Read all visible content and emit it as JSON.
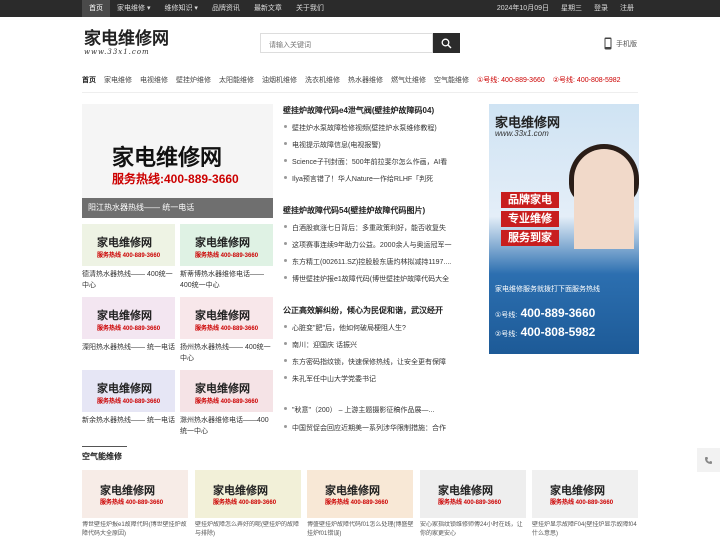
{
  "topbar": {
    "nav": [
      "首页",
      "家电维修",
      "维修知识",
      "品牌资讯",
      "最新文章",
      "关于我们"
    ],
    "date": "2024年10月09日",
    "weekday": "星期三",
    "login": "登录",
    "register": "注册"
  },
  "logo": {
    "title": "家电维修网",
    "url": "www.33x1.com"
  },
  "search": {
    "placeholder": "请输入关键词"
  },
  "mobile": {
    "label": "手机版"
  },
  "catnav": {
    "items": [
      "首页",
      "家电维修",
      "电视维修",
      "壁挂炉维修",
      "太阳能维修",
      "油烟机维修",
      "洗衣机维修",
      "热水器维修",
      "燃气灶维修",
      "空气能维修"
    ],
    "hot1": "①号线: 400-889-3660",
    "hot2": "②号线: 400-808-5982"
  },
  "banner": {
    "t1": "家电维修网",
    "t2": "服务热线:400-889-3660",
    "caption": "阳江热水器热线—— 统一电话"
  },
  "thumbs": [
    {
      "a": "家电维修网",
      "b": "服务热线 400-889-3660",
      "caption": "德清热水器热线—— 400统一中心"
    },
    {
      "a": "家电维修网",
      "b": "服务热线 400-889-3660",
      "caption": "斯蒂博热水器维修电话——400统一中心"
    },
    {
      "a": "家电维修网",
      "b": "服务热线 400-889-3660",
      "caption": "溧阳热水器热线—— 统一电话"
    },
    {
      "a": "家电维修网",
      "b": "服务热线 400-889-3660",
      "caption": "扬州热水器热线—— 400统一中心"
    },
    {
      "a": "家电维修网",
      "b": "服务热线 400-889-3660",
      "caption": "新余热水器热线—— 统一电话"
    },
    {
      "a": "家电维修网",
      "b": "服务热线 400-889-3660",
      "caption": "滁州热水器维修电话——400统一中心"
    }
  ],
  "mid": {
    "g1": {
      "h": "壁挂炉故障代码e4泄气阀(壁挂炉故障码04)",
      "items": [
        "壁挂炉水泵故障检修视频(壁挂炉水泵维修教程)",
        "电视提示故障信息(电视报警)",
        "Science子刊封面：500年前拉斐尔怎么作画，AI看",
        "Ilya预言错了！华人Nature一作给RLHF「判死"
      ]
    },
    "g2": {
      "h": "壁挂炉故障代码54(壁挂炉故障代码图片)",
      "items": [
        "白酒股疯涨七日背后：多重政策利好，能否收复失",
        "这项赛事连续9年助力公益。2000余人与奥运冠军一",
        "东方精工(002611.SZ)控股股东唐灼林拟减持1197....",
        "博世壁挂炉报e1故障代码(博世壁挂炉故障代码大全"
      ]
    },
    "g3": {
      "h": "公正高效解纠纷，倾心为民促和谐，武汉经开",
      "items": [
        "心脏变\"肥\"后，他如何破局梗阻人生?",
        "南川：迎国庆 话振兴",
        "东方密码指纹锁，快速保修热线，让安全更有保障",
        "朱孔军任中山大学党委书记"
      ]
    },
    "g4": {
      "items": [
        "\"秋意\"（200） – 上游主题摄影征稿作品展—...",
        "中国贸促会回应近期美一系列涉华限制措施：合作"
      ]
    }
  },
  "ad": {
    "l1": "家电维修网",
    "l2": "www.33x1.com",
    "s1": "品牌家电",
    "s2": "专业维修",
    "s3": "服务到家",
    "line": "家电维修服务就拨打下面服务热线",
    "p1n": "①号线:",
    "p1": "400-889-3660",
    "p2n": "②号线:",
    "p2": "400-808-5982"
  },
  "section": {
    "title": "空气能维修"
  },
  "cards": [
    {
      "a": "家电维修网",
      "b": "服务热线 400-889-3660",
      "caption": "博世壁挂炉报e1故障代码(博世壁挂炉故障代码大全原因)"
    },
    {
      "a": "家电维修网",
      "b": "服务热线 400-889-3660",
      "caption": "壁挂炉故障怎么弄好的呢(壁挂炉的故障与排除)"
    },
    {
      "a": "家电维修网",
      "b": "服务热线 400-889-3660",
      "caption": "博盛壁挂炉故障代码f01怎么处理(博盛壁挂炉f01错误)"
    },
    {
      "a": "家电维修网",
      "b": "服务热线 400-889-3660",
      "caption": "安心家指纹锁维修师傅24小时在线，让你的家更安心"
    },
    {
      "a": "家电维修网",
      "b": "服务热线 400-889-3660",
      "caption": "壁挂炉显示故障F04(壁挂炉显示故障f04什么意思)"
    }
  ],
  "colors": {
    "topbar": "#2b2b2b",
    "accent_red": "#cc0000",
    "ad_blue": "#1d5a97"
  }
}
